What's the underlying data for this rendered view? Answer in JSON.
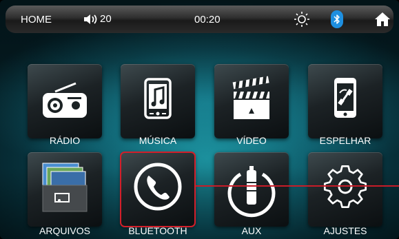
{
  "status_bar": {
    "home_label": "HOME",
    "volume_value": "20",
    "clock": "00:20",
    "icons": [
      "volume-icon",
      "brightness-icon",
      "bluetooth-icon",
      "home-icon"
    ],
    "bluetooth_color": "#1e8fe0"
  },
  "apps": [
    {
      "label": "RÁDIO",
      "icon": "radio-icon"
    },
    {
      "label": "MÚSICA",
      "icon": "music-player-icon"
    },
    {
      "label": "VÍDEO",
      "icon": "clapperboard-icon"
    },
    {
      "label": "ESPELHAR",
      "icon": "phone-mirror-icon"
    },
    {
      "label": "ARQUIVOS",
      "icon": "photo-folder-icon"
    },
    {
      "label": "BLUETOOTH",
      "icon": "phone-handset-icon",
      "selected": true
    },
    {
      "label": "AUX",
      "icon": "aux-jack-icon"
    },
    {
      "label": "AJUSTES",
      "icon": "settings-gear-icon"
    }
  ],
  "colors": {
    "selection": "#d31f2a",
    "background_accent": "#1a8a96"
  }
}
